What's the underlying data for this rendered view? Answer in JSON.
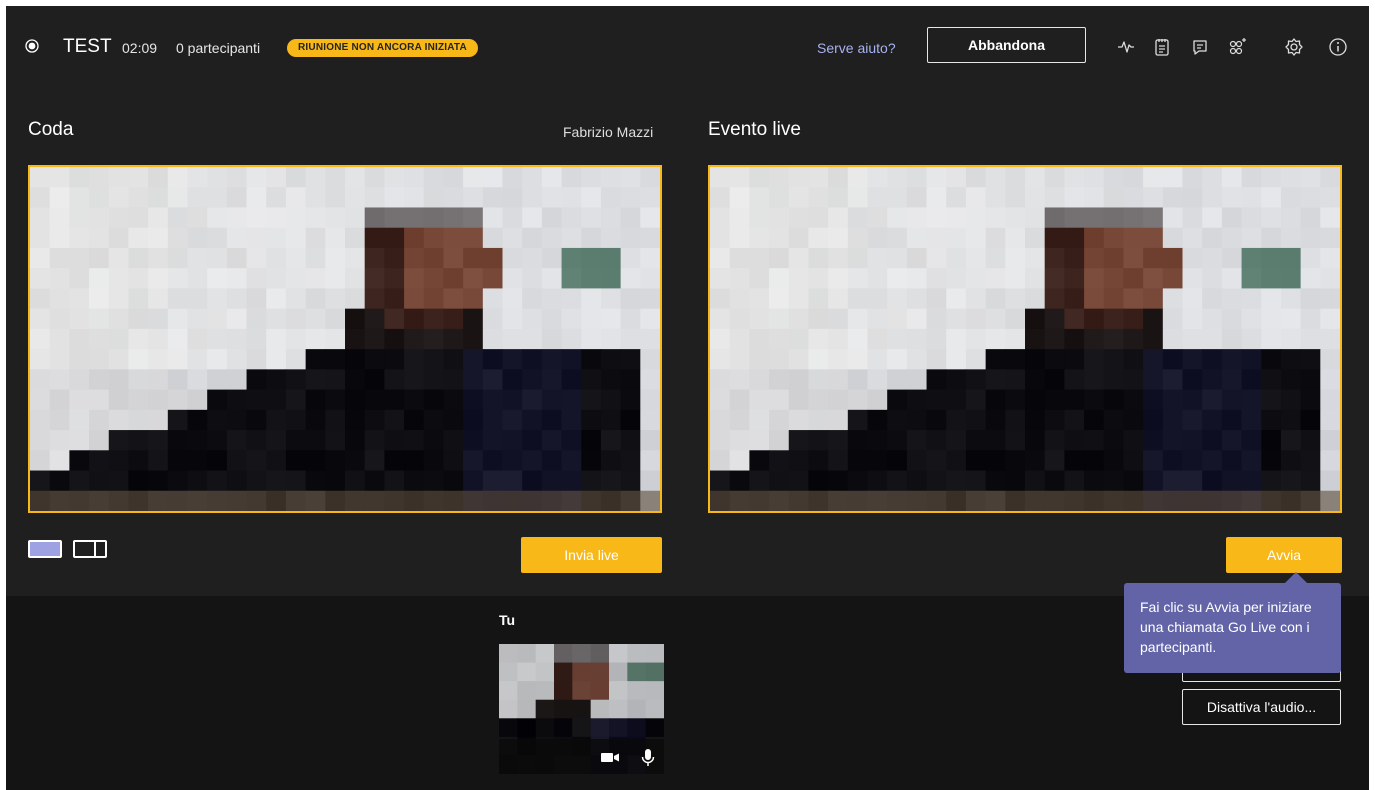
{
  "meeting": {
    "title": "TEST",
    "timer": "02:09",
    "participants": "0 partecipanti",
    "status_badge": "RIUNIONE NON ANCORA INIZIATA"
  },
  "toolbar": {
    "help_label": "Serve aiuto?",
    "leave_label": "Abbandona",
    "icons": [
      "health-icon",
      "meeting-notes-icon",
      "chat-icon",
      "participants-icon",
      "settings-icon",
      "info-icon"
    ]
  },
  "queue": {
    "title": "Coda",
    "presenter": "Fabrizio Mazzi",
    "send_live_label": "Invia live"
  },
  "live": {
    "title": "Evento live",
    "start_label": "Avvia"
  },
  "tooltip": {
    "text": "Fai clic su Avvia per iniziare una chiamata Go Live con i partecipanti."
  },
  "self": {
    "label": "Tu",
    "mute_all_label": "Disattiva l'audio..."
  },
  "colors": {
    "accent": "#f8b817",
    "tooltip": "#6264a7",
    "link": "#a8b1f0",
    "background": "#1f1f1f",
    "bottom_background": "#141414"
  }
}
